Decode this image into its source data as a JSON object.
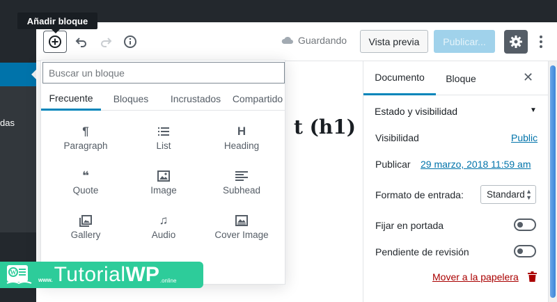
{
  "tooltip": "Añadir bloque",
  "toolbar": {
    "add_icon": "plus-circle-icon",
    "undo_icon": "undo-icon",
    "redo_icon": "redo-icon",
    "info_icon": "info-icon",
    "saving_label": "Guardando",
    "preview_label": "Vista previa",
    "publish_label": "Publicar...",
    "settings_icon": "gear-icon",
    "more_icon": "more-vertical-icon"
  },
  "admin_sidebar": {
    "submenu_label": "das"
  },
  "editor": {
    "heading_fragment": "t (h1)"
  },
  "inserter": {
    "search_placeholder": "Buscar un bloque",
    "tabs": [
      {
        "label": "Frecuente",
        "active": true
      },
      {
        "label": "Bloques",
        "active": false
      },
      {
        "label": "Incrustados",
        "active": false
      },
      {
        "label": "Compartido",
        "active": false
      }
    ],
    "blocks": [
      {
        "label": "Paragraph",
        "icon": "paragraph-icon",
        "glyph": "¶"
      },
      {
        "label": "List",
        "icon": "list-icon",
        "glyph": "☰"
      },
      {
        "label": "Heading",
        "icon": "heading-icon",
        "glyph": "H"
      },
      {
        "label": "Quote",
        "icon": "quote-icon",
        "glyph": "❝"
      },
      {
        "label": "Image",
        "icon": "image-icon",
        "glyph": "▣"
      },
      {
        "label": "Subhead",
        "icon": "subhead-icon",
        "glyph": "≣"
      },
      {
        "label": "Gallery",
        "icon": "gallery-icon",
        "glyph": "❐"
      },
      {
        "label": "Audio",
        "icon": "audio-icon",
        "glyph": "♫"
      },
      {
        "label": "Cover Image",
        "icon": "cover-image-icon",
        "glyph": "▣"
      }
    ]
  },
  "sidebar": {
    "tabs": [
      {
        "label": "Documento",
        "active": true
      },
      {
        "label": "Bloque",
        "active": false
      }
    ],
    "close_icon": "close-icon",
    "panel_title": "Estado y visibilidad",
    "panel_toggle": "▼",
    "visibility_label": "Visibilidad",
    "visibility_value": "Public",
    "publish_label": "Publicar",
    "publish_value": "29 marzo, 2018 11:59 am",
    "format_label": "Formato de entrada:",
    "format_value": "Standard",
    "sticky_label": "Fijar en portada",
    "sticky_on": false,
    "pending_label": "Pendiente de revisión",
    "pending_on": false,
    "trash_label": "Mover a la papelera",
    "trash_icon": "trash-icon"
  },
  "logo": {
    "prefix": "www.",
    "word": "Tutorial",
    "word_bold": "WP",
    "tld": ".online"
  },
  "colors": {
    "accent": "#0085ba",
    "publish_disabled": "#a0d2eb",
    "danger": "#aa0000",
    "logo": "#2dcc9a"
  }
}
